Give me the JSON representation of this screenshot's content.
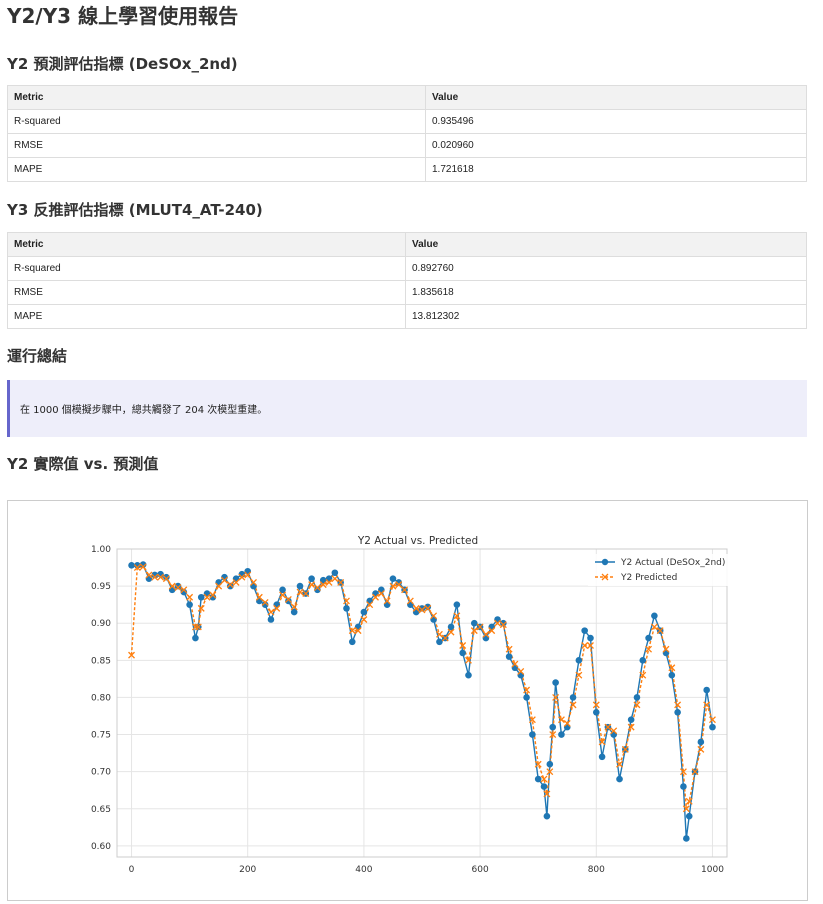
{
  "report_title": "Y2/Y3 線上學習使用報告",
  "y2_section": {
    "heading": "Y2 預測評估指標 (DeSOx_2nd)",
    "columns": [
      "Metric",
      "Value"
    ],
    "rows": [
      [
        "R-squared",
        "0.935496"
      ],
      [
        "RMSE",
        "0.020960"
      ],
      [
        "MAPE",
        "1.721618"
      ]
    ]
  },
  "y3_section": {
    "heading": "Y3 反推評估指標 (MLUT4_AT-240)",
    "columns": [
      "Metric",
      "Value"
    ],
    "rows": [
      [
        "R-squared",
        "0.892760"
      ],
      [
        "RMSE",
        "1.835618"
      ],
      [
        "MAPE",
        "13.812302"
      ]
    ]
  },
  "summary": {
    "heading": "運行總結",
    "text": "在 1000 個模擬步驟中，總共觸發了 204 次模型重建。"
  },
  "chart_section": {
    "heading": "Y2 實際值 vs. 預測值"
  },
  "chart_data": {
    "type": "line",
    "title": "Y2 Actual vs. Predicted",
    "xlabel": "",
    "ylabel": "",
    "xlim": [
      -25,
      1025
    ],
    "ylim": [
      0.585,
      1.0
    ],
    "xticks": [
      0,
      200,
      400,
      600,
      800,
      1000
    ],
    "yticks": [
      0.6,
      0.65,
      0.7,
      0.75,
      0.8,
      0.85,
      0.9,
      0.95,
      1.0
    ],
    "grid": true,
    "legend_position": "top-right",
    "colors": {
      "actual": "#1f77b4",
      "predicted": "#ff7f0e"
    },
    "series": [
      {
        "name": "Y2 Actual (DeSOx_2nd)",
        "marker": "circle",
        "line": "solid",
        "x": [
          0,
          10,
          20,
          30,
          40,
          50,
          60,
          70,
          80,
          90,
          100,
          110,
          115,
          120,
          130,
          140,
          150,
          160,
          170,
          180,
          190,
          200,
          210,
          220,
          230,
          240,
          250,
          260,
          270,
          280,
          290,
          300,
          310,
          320,
          330,
          340,
          350,
          360,
          370,
          380,
          390,
          400,
          410,
          420,
          430,
          440,
          450,
          460,
          470,
          480,
          490,
          500,
          510,
          520,
          530,
          540,
          550,
          560,
          570,
          580,
          590,
          600,
          610,
          620,
          630,
          640,
          650,
          660,
          670,
          680,
          690,
          700,
          710,
          715,
          720,
          725,
          730,
          740,
          750,
          760,
          770,
          780,
          790,
          800,
          810,
          820,
          830,
          840,
          850,
          860,
          870,
          880,
          890,
          900,
          910,
          920,
          930,
          940,
          950,
          955,
          960,
          970,
          980,
          990,
          1000
        ],
        "y": [
          0.978,
          0.978,
          0.979,
          0.96,
          0.965,
          0.966,
          0.962,
          0.945,
          0.95,
          0.942,
          0.925,
          0.88,
          0.895,
          0.935,
          0.94,
          0.935,
          0.955,
          0.962,
          0.95,
          0.96,
          0.966,
          0.97,
          0.95,
          0.93,
          0.925,
          0.905,
          0.925,
          0.945,
          0.93,
          0.915,
          0.95,
          0.94,
          0.96,
          0.945,
          0.958,
          0.96,
          0.968,
          0.955,
          0.92,
          0.875,
          0.895,
          0.915,
          0.93,
          0.94,
          0.945,
          0.925,
          0.96,
          0.955,
          0.945,
          0.925,
          0.915,
          0.92,
          0.922,
          0.905,
          0.875,
          0.88,
          0.895,
          0.925,
          0.86,
          0.83,
          0.9,
          0.895,
          0.88,
          0.895,
          0.905,
          0.9,
          0.855,
          0.84,
          0.83,
          0.8,
          0.75,
          0.69,
          0.68,
          0.64,
          0.71,
          0.76,
          0.82,
          0.75,
          0.76,
          0.8,
          0.85,
          0.89,
          0.88,
          0.78,
          0.72,
          0.76,
          0.75,
          0.69,
          0.73,
          0.77,
          0.8,
          0.85,
          0.88,
          0.91,
          0.89,
          0.86,
          0.83,
          0.78,
          0.68,
          0.61,
          0.64,
          0.7,
          0.74,
          0.81,
          0.76
        ]
      },
      {
        "name": "Y2 Predicted",
        "marker": "x",
        "line": "dashed",
        "x": [
          0,
          10,
          20,
          30,
          40,
          50,
          60,
          70,
          80,
          90,
          100,
          110,
          115,
          120,
          130,
          140,
          150,
          160,
          170,
          180,
          190,
          200,
          210,
          220,
          230,
          240,
          250,
          260,
          270,
          280,
          290,
          300,
          310,
          320,
          330,
          340,
          350,
          360,
          370,
          380,
          390,
          400,
          410,
          420,
          430,
          440,
          450,
          460,
          470,
          480,
          490,
          500,
          510,
          520,
          530,
          540,
          550,
          560,
          570,
          580,
          590,
          600,
          610,
          620,
          630,
          640,
          650,
          660,
          670,
          680,
          690,
          700,
          710,
          715,
          720,
          725,
          730,
          740,
          750,
          760,
          770,
          780,
          790,
          800,
          810,
          820,
          830,
          840,
          850,
          860,
          870,
          880,
          890,
          900,
          910,
          920,
          930,
          940,
          950,
          955,
          960,
          970,
          980,
          990,
          1000
        ],
        "y": [
          0.857,
          0.975,
          0.976,
          0.965,
          0.962,
          0.962,
          0.96,
          0.95,
          0.948,
          0.945,
          0.935,
          0.895,
          0.895,
          0.92,
          0.935,
          0.938,
          0.95,
          0.958,
          0.952,
          0.955,
          0.962,
          0.965,
          0.955,
          0.935,
          0.928,
          0.915,
          0.92,
          0.938,
          0.932,
          0.922,
          0.942,
          0.94,
          0.952,
          0.948,
          0.952,
          0.955,
          0.96,
          0.955,
          0.93,
          0.89,
          0.89,
          0.905,
          0.925,
          0.935,
          0.94,
          0.93,
          0.95,
          0.952,
          0.945,
          0.93,
          0.92,
          0.918,
          0.92,
          0.91,
          0.885,
          0.88,
          0.888,
          0.91,
          0.87,
          0.85,
          0.89,
          0.895,
          0.885,
          0.89,
          0.9,
          0.898,
          0.865,
          0.845,
          0.835,
          0.81,
          0.77,
          0.71,
          0.69,
          0.67,
          0.7,
          0.75,
          0.8,
          0.77,
          0.765,
          0.79,
          0.83,
          0.87,
          0.87,
          0.79,
          0.74,
          0.76,
          0.755,
          0.71,
          0.73,
          0.76,
          0.79,
          0.83,
          0.865,
          0.895,
          0.89,
          0.865,
          0.84,
          0.79,
          0.7,
          0.65,
          0.66,
          0.7,
          0.73,
          0.79,
          0.77
        ]
      }
    ]
  }
}
